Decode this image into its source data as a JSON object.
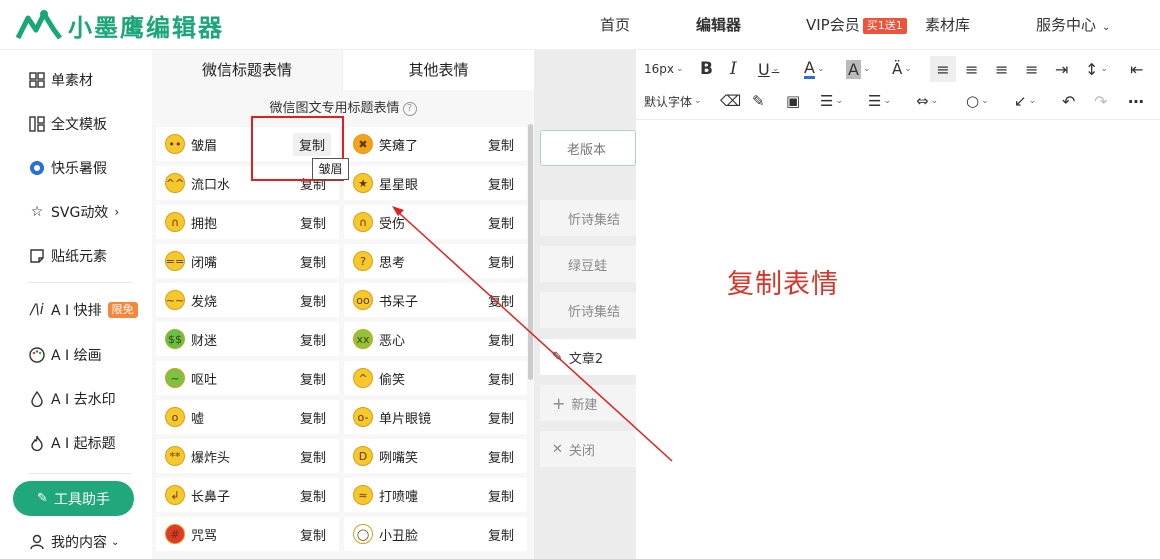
{
  "header": {
    "logo_text": "小墨鹰编辑器",
    "nav": {
      "home": "首页",
      "editor": "编辑器",
      "vip": "VIP会员",
      "vip_badge": "买1送1",
      "materials": "素材库",
      "service": "服务中心"
    }
  },
  "sidebar": {
    "items": [
      {
        "label": "单素材",
        "icon": "grid-icon"
      },
      {
        "label": "全文模板",
        "icon": "template-icon"
      },
      {
        "label": "快乐暑假",
        "icon": "soccer-ball-icon"
      },
      {
        "label": "SVG动效",
        "icon": "star-icon"
      },
      {
        "label": "贴纸元素",
        "icon": "sticker-icon"
      },
      {
        "label": "A I 快排",
        "icon": "ai-icon",
        "badge": "限免"
      },
      {
        "label": "A I 绘画",
        "icon": "palette-icon"
      },
      {
        "label": "A I 去水印",
        "icon": "drop-icon"
      },
      {
        "label": "A I 起标题",
        "icon": "fire-icon"
      }
    ],
    "tool_button": "工具助手",
    "my_content": "我的内容"
  },
  "panel": {
    "tabs": [
      "微信标题表情",
      "其他表情"
    ],
    "subtitle": "微信图文专用标题表情",
    "copy_label": "复制",
    "tooltip": "皱眉",
    "emojis": [
      [
        "皱眉",
        "笑瘫了"
      ],
      [
        "流口水",
        "星星眼"
      ],
      [
        "拥抱",
        "受伤"
      ],
      [
        "闭嘴",
        "思考"
      ],
      [
        "发烧",
        "书呆子"
      ],
      [
        "财迷",
        "恶心"
      ],
      [
        "呕吐",
        "偷笑"
      ],
      [
        "嘘",
        "单片眼镜"
      ],
      [
        "爆炸头",
        "咧嘴笑"
      ],
      [
        "长鼻子",
        "打喷嚏"
      ],
      [
        "咒骂",
        "小丑脸"
      ]
    ]
  },
  "middle": {
    "old_version": "老版本",
    "items": [
      "忻诗集结",
      "绿豆蛙",
      "忻诗集结"
    ],
    "article": "文章2",
    "new": "新建",
    "close": "关闭"
  },
  "editor": {
    "font_size": "16px",
    "font_family": "默认字体",
    "annotation": "复制表情"
  }
}
